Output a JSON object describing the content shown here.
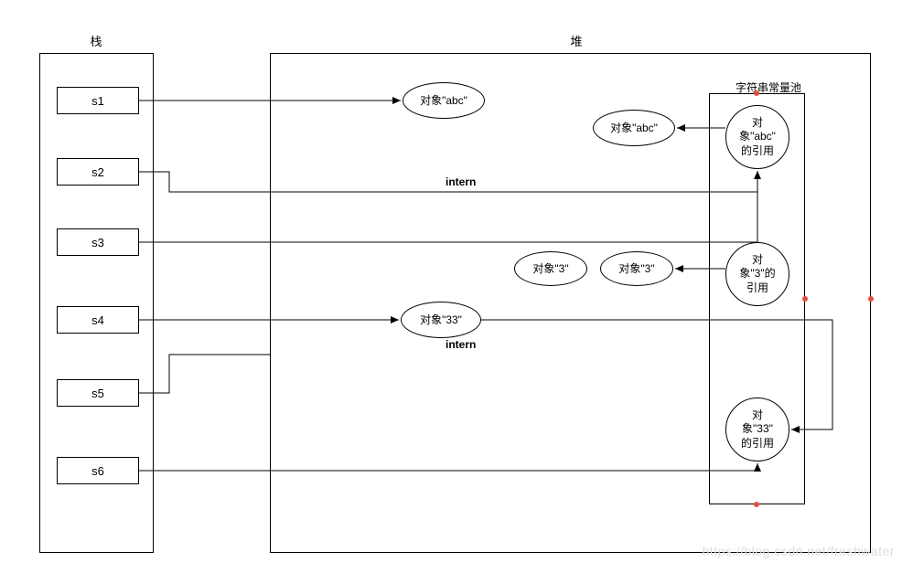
{
  "titles": {
    "stack": "栈",
    "heap": "堆",
    "pool": "字符串常量池"
  },
  "stack_vars": {
    "s1": "s1",
    "s2": "s2",
    "s3": "s3",
    "s4": "s4",
    "s5": "s5",
    "s6": "s6"
  },
  "heap_objects": {
    "obj_abc_1": "对象\"abc\"",
    "obj_abc_2": "对象\"abc\"",
    "obj_3_a": "对象\"3\"",
    "obj_3_b": "对象\"3\"",
    "obj_33": "对象\"33\""
  },
  "pool_refs": {
    "ref_abc": "对\n象\"abc\"\n的引用",
    "ref_3": "对\n象\"3\"的\n引用",
    "ref_33": "对\n象\"33\"\n的引用"
  },
  "labels": {
    "intern1": "intern",
    "intern2": "intern"
  },
  "watermark": "https://blog.csdn.net/freshwater"
}
